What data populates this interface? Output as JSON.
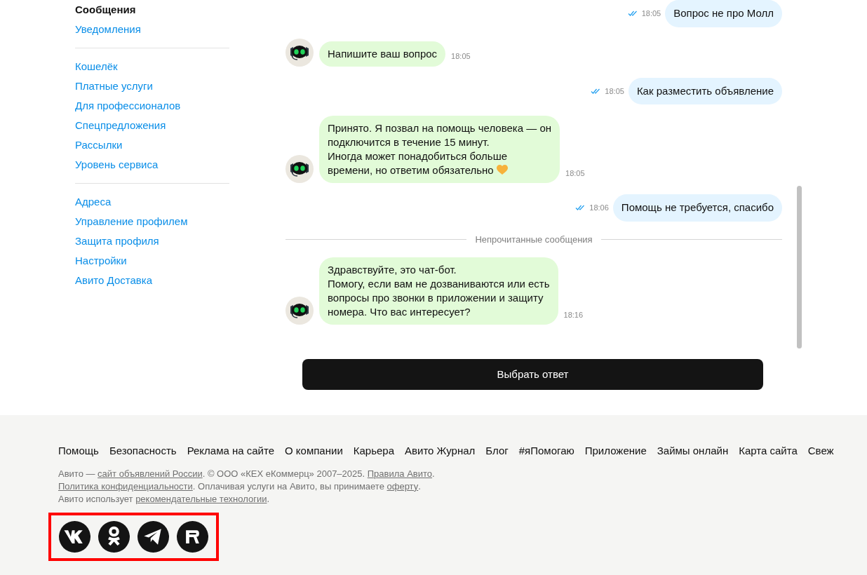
{
  "sidebar": {
    "groups": [
      {
        "items": [
          {
            "label": "Сообщения",
            "selected": true
          },
          {
            "label": "Уведомления",
            "selected": false
          }
        ]
      },
      {
        "items": [
          {
            "label": "Кошелёк",
            "selected": false
          },
          {
            "label": "Платные услуги",
            "selected": false
          },
          {
            "label": "Для профессионалов",
            "selected": false
          },
          {
            "label": "Спецпредложения",
            "selected": false
          },
          {
            "label": "Рассылки",
            "selected": false
          },
          {
            "label": "Уровень сервиса",
            "selected": false
          }
        ]
      },
      {
        "items": [
          {
            "label": "Адреса",
            "selected": false
          },
          {
            "label": "Управление профилем",
            "selected": false
          },
          {
            "label": "Защита профиля",
            "selected": false
          },
          {
            "label": "Настройки",
            "selected": false
          },
          {
            "label": "Авито Доставка",
            "selected": false
          }
        ]
      }
    ]
  },
  "chat": {
    "messages": [
      {
        "kind": "outgoing",
        "text": "Вопрос не про Молл",
        "time": "18:05",
        "read": true
      },
      {
        "kind": "incoming",
        "text": "Напишите ваш вопрос",
        "time": "18:05",
        "heart": false
      },
      {
        "kind": "outgoing",
        "text": "Как разместить объявление",
        "time": "18:05",
        "read": true
      },
      {
        "kind": "incoming",
        "text": "Принято. Я позвал на помощь человека — он\nподключится в течение 15 минут.\nИногда может понадобиться больше\nвремени, но ответим обязательно",
        "time": "18:05",
        "heart": true
      },
      {
        "kind": "outgoing",
        "text": "Помощь не требуется, спасибо",
        "time": "18:06",
        "read": true
      },
      {
        "kind": "divider",
        "text": "Непрочитанные сообщения"
      },
      {
        "kind": "incoming",
        "text": "Здравствуйте, это чат-бот.\nПомогу, если вам не дозваниваются или есть\nвопросы про звонки в приложении и защиту\nномера. Что вас интересует?",
        "time": "18:16",
        "heart": false
      }
    ],
    "answer_button": "Выбрать ответ"
  },
  "footer": {
    "links": [
      "Помощь",
      "Безопасность",
      "Реклама на сайте",
      "О компании",
      "Карьера",
      "Авито Журнал",
      "Блог",
      "#яПомогаю",
      "Приложение",
      "Займы онлайн",
      "Карта сайта",
      "Свеж"
    ],
    "legal": [
      [
        {
          "kind": "text",
          "text": "Авито — "
        },
        {
          "kind": "link",
          "text": "сайт объявлений России"
        },
        {
          "kind": "text",
          "text": ". © ООО «КЕХ еКоммерц» 2007–2025. "
        },
        {
          "kind": "link",
          "text": "Правила Авито"
        },
        {
          "kind": "text",
          "text": "."
        }
      ],
      [
        {
          "kind": "link",
          "text": "Политика конфиденциальности"
        },
        {
          "kind": "text",
          "text": ". Оплачивая услуги на Авито, вы принимаете "
        },
        {
          "kind": "link",
          "text": "оферту"
        },
        {
          "kind": "text",
          "text": "."
        }
      ],
      [
        {
          "kind": "text",
          "text": "Авито использует "
        },
        {
          "kind": "link",
          "text": "рекомендательные технологии"
        },
        {
          "kind": "text",
          "text": "."
        }
      ]
    ],
    "social": [
      {
        "kind": "vk"
      },
      {
        "kind": "ok"
      },
      {
        "kind": "telegram"
      },
      {
        "kind": "rutube"
      }
    ],
    "social_highlighted": true
  }
}
